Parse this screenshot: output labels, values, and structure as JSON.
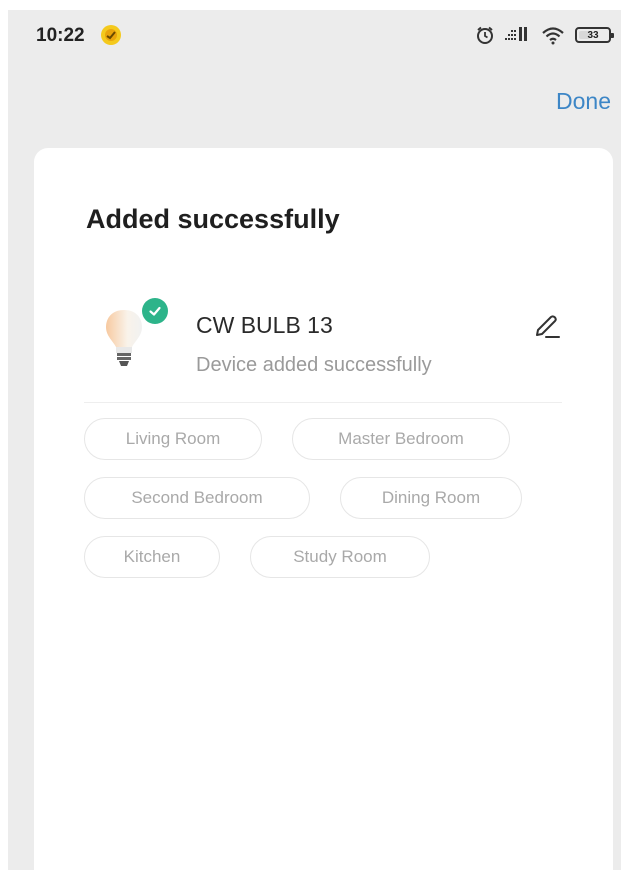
{
  "status_bar": {
    "time": "10:22",
    "battery_level": "33",
    "icons": [
      "notification-app-icon",
      "alarm-icon",
      "signal-icon",
      "wifi-icon",
      "battery-icon"
    ]
  },
  "header": {
    "done_label": "Done",
    "accent_color": "#3d86c6"
  },
  "card": {
    "title": "Added successfully",
    "device": {
      "name": "CW BULB 13",
      "status": "Device added successfully",
      "icon": "light-bulb-icon",
      "badge_icon": "check-icon",
      "badge_color": "#2db48a"
    },
    "rooms": [
      "Living Room",
      "Master Bedroom",
      "Second Bedroom",
      "Dining Room",
      "Kitchen",
      "Study Room"
    ]
  }
}
